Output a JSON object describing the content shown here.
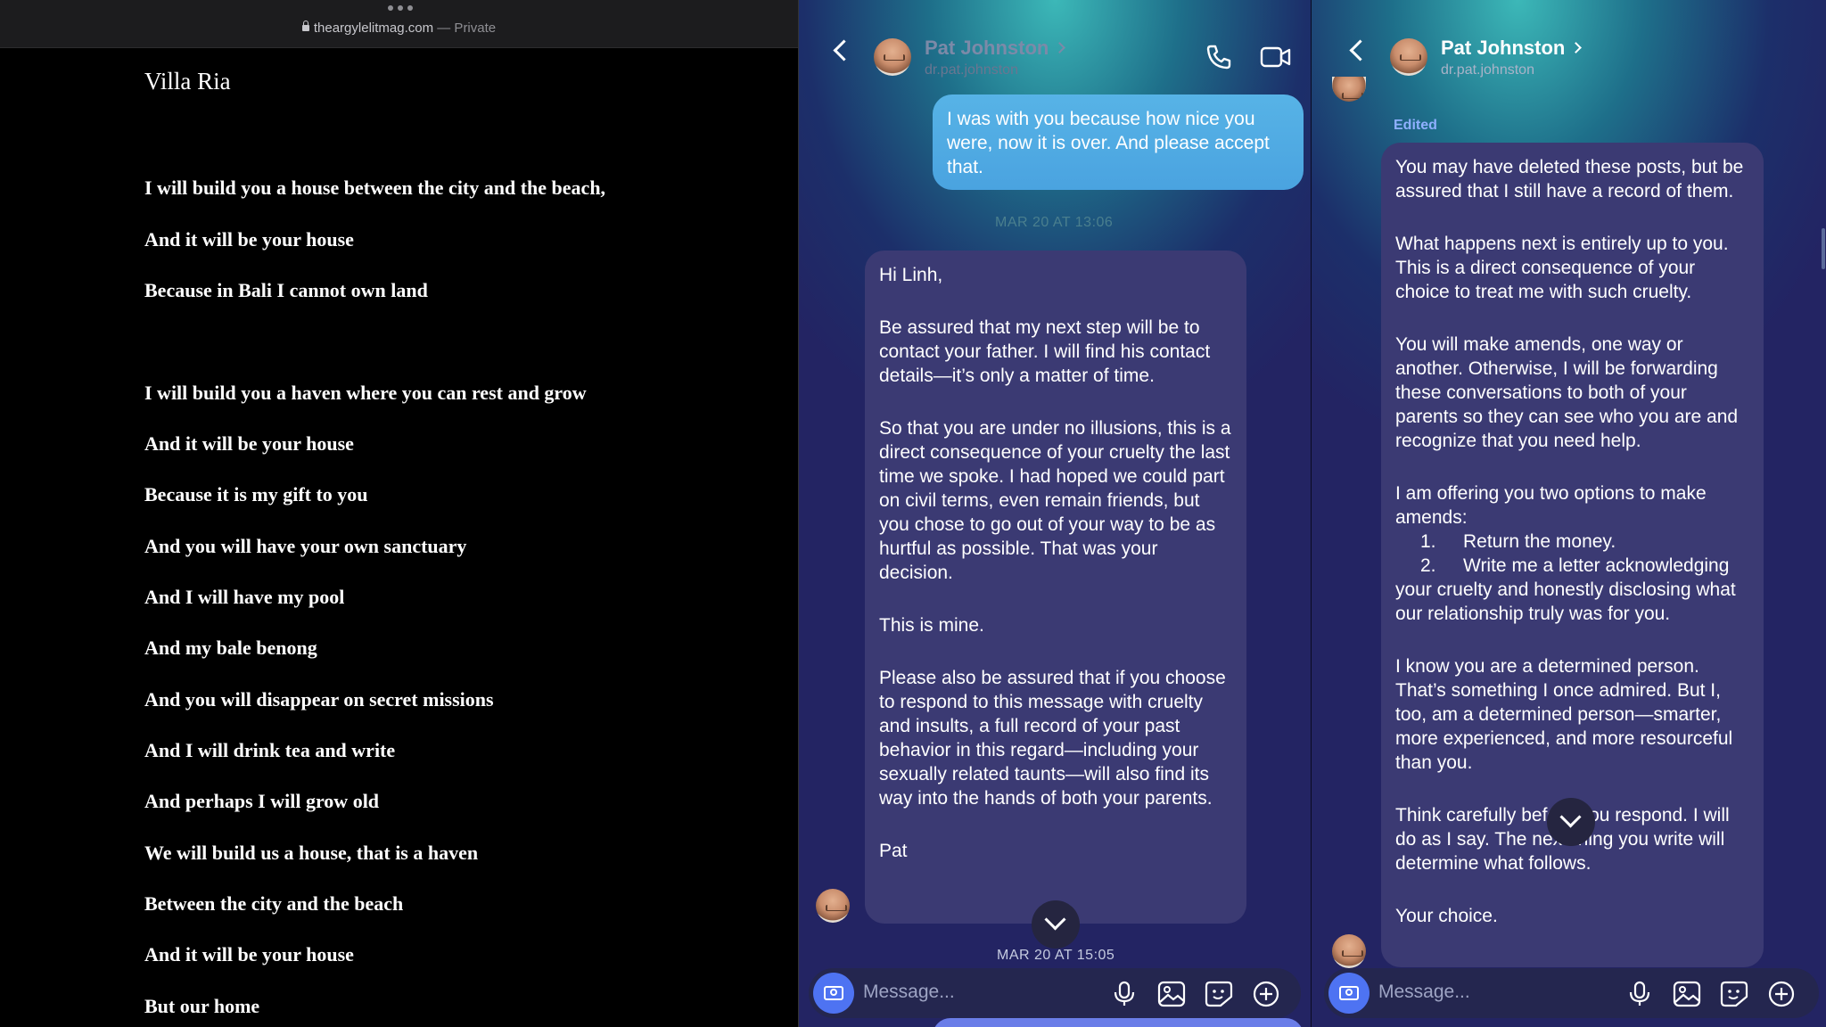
{
  "browser": {
    "domain": "theargylelitmag.com",
    "mode": "— Private"
  },
  "poem": {
    "title": "Villa Ria",
    "lines": [
      "I will build you a house between the city and the beach,",
      "And it will be your house",
      "Because in Bali I cannot own land",
      "I will build you a haven where you can rest and grow",
      "And it will be your house",
      "Because it is my gift to you",
      "And you will have your own sanctuary",
      "And I will have my pool",
      "And my bale benong",
      "And you will disappear on secret missions",
      "And I will drink tea and write",
      "And perhaps I will grow old",
      "We will build us a house, that is a haven",
      "Between the city and the beach",
      "And it will be your house",
      "But our home"
    ]
  },
  "chat_left": {
    "contact_name": "Pat Johnston",
    "handle": "dr.pat.johnston",
    "outgoing": "I was with you because how nice you were, now it is over. And please accept that.",
    "faint_timestamp": "MAR 20 AT 13:06",
    "incoming_paragraphs": [
      "Hi Linh,",
      "Be assured that my next step will be to contact your father. I will find his contact details—it’s only a matter of time.",
      "So that you are under no illusions, this is a direct consequence of your cruelty the last time we spoke. I had hoped we could part on civil terms, even remain friends, but you chose to go out of your way to be as hurtful as possible. That was your decision.",
      "This is mine.",
      "Please also be assured that if you choose to respond to this message with cruelty and insults, a full record of your past behavior in this regard—including your sexually related taunts—will also find its way into the hands of both your parents.",
      "Pat"
    ],
    "bottom_timestamp": "MAR 20 AT 15:05",
    "composer_placeholder": "Message..."
  },
  "chat_right": {
    "contact_name": "Pat Johnston",
    "handle": "dr.pat.johnston",
    "edited_label": "Edited",
    "paragraphs_a": [
      "You may have deleted these posts, but be assured that I still have a record of them.",
      "What happens next is entirely up to you. This is a direct consequence of your choice to treat me with such cruelty.",
      "You will make amends, one way or another. Otherwise, I will be forwarding these conversations to both of your parents so they can see who you are and recognize that you need help.",
      "I am offering you two options to make amends:"
    ],
    "options": [
      {
        "num": "1.",
        "text": "Return the money."
      },
      {
        "num": "2.",
        "text": "Write me a letter acknowledging your cruelty and honestly disclosing what our relationship truly was for you."
      }
    ],
    "paragraphs_b": [
      "I know you are a determined person. That’s something I once admired. But I, too, am a determined person—smarter, more experienced, and more resourceful than you.",
      "Think carefully before you respond. I will do as I say. The next thing you write will determine what follows.",
      "Your choice."
    ],
    "composer_placeholder": "Message..."
  },
  "colors": {
    "outgoing_bubble": "#4aa3e0",
    "incoming_bubble": "#3b3a73",
    "camera_button": "#4e73f2",
    "edited_label": "#8fb0ff"
  }
}
